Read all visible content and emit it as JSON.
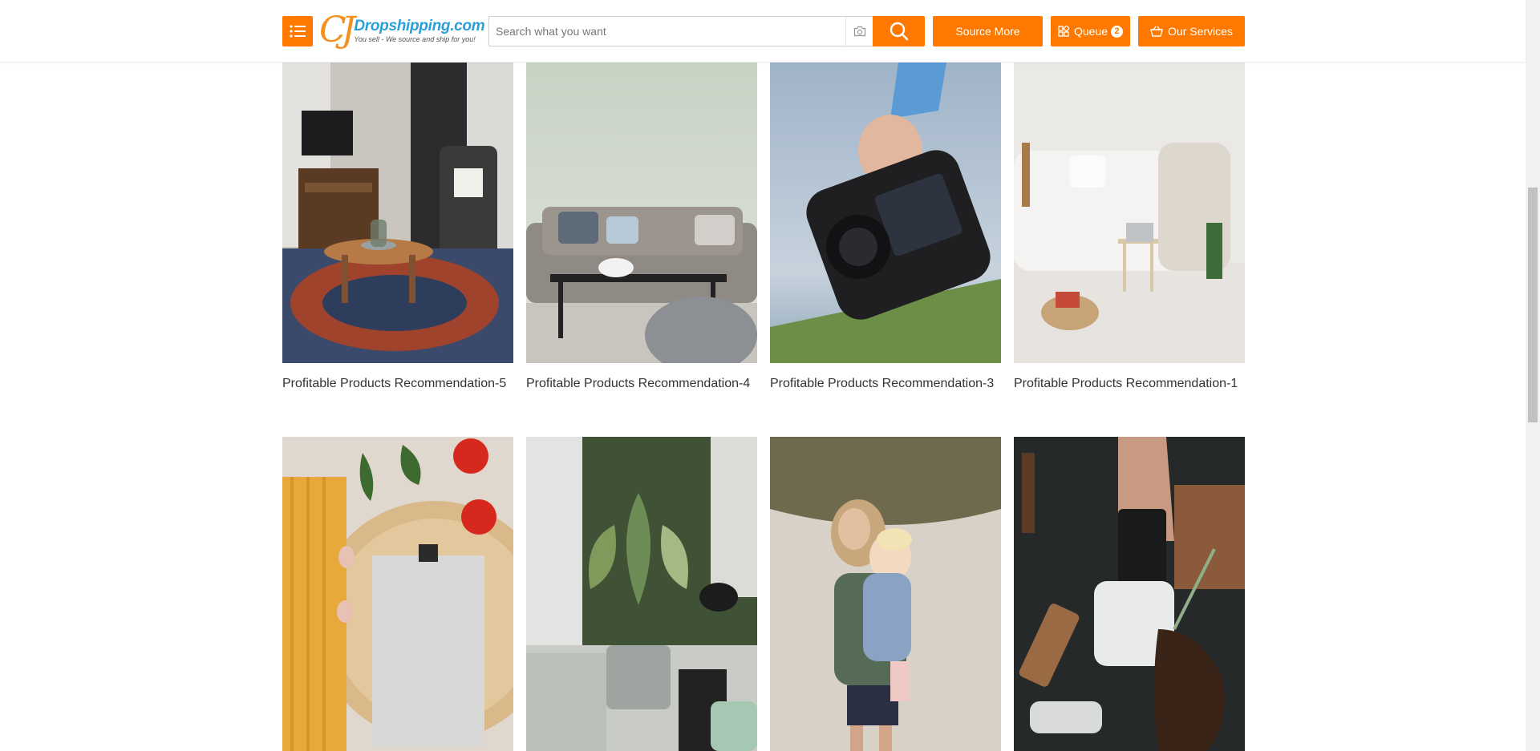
{
  "header": {
    "logo_main": "Dropshipping.com",
    "logo_cj": "CJ",
    "logo_tagline": "You sell - We source and ship for you!",
    "search_placeholder": "Search what you want",
    "source_more_label": "Source More",
    "queue_label": "Queue",
    "queue_count": "2",
    "our_services_label": "Our Services"
  },
  "colors": {
    "accent": "#ff7900",
    "logo_blue": "#2a9fd8",
    "logo_orange": "#f5901e"
  },
  "cards_row1": [
    {
      "caption": "Profitable Products Recommendation-5",
      "scene": "living room with armchair and round coffee table"
    },
    {
      "caption": "Profitable Products Recommendation-4",
      "scene": "grey sofa with black coffee table and pouf"
    },
    {
      "caption": "Profitable Products Recommendation-3",
      "scene": "hand holding DSLR camera against sky"
    },
    {
      "caption": "Profitable Products Recommendation-1",
      "scene": "white sofa with laptop on stool"
    }
  ],
  "cards_row2": [
    {
      "scene": "spaghetti, tomatoes and clipboard on table"
    },
    {
      "scene": "hands potting house plants"
    },
    {
      "scene": "woman holding baby in carrier on beach"
    },
    {
      "scene": "card reader and credit card on dark desk"
    }
  ]
}
